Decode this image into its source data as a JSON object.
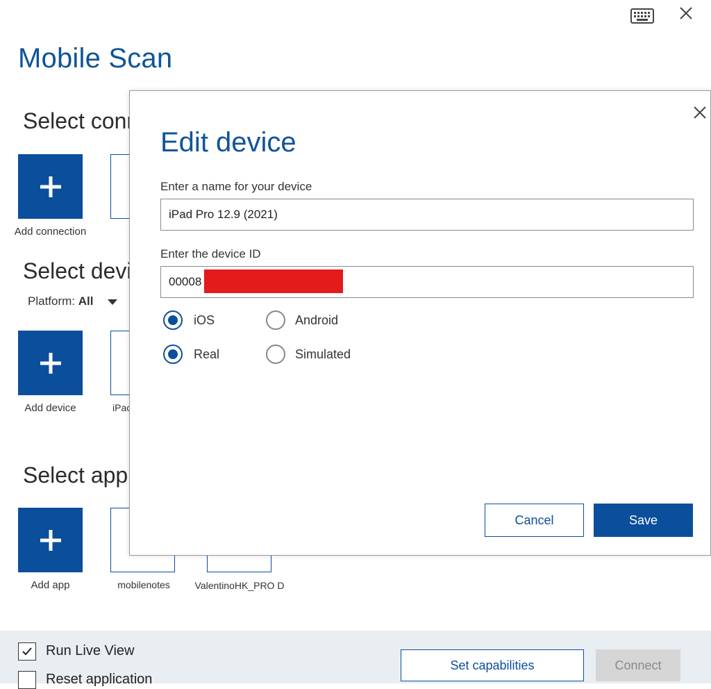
{
  "window": {
    "title": "Mobile Scan",
    "icons": [
      "keyboard-icon",
      "close-icon"
    ]
  },
  "sections": {
    "connection": {
      "title": "Select conn",
      "add_label": "Add connection"
    },
    "device": {
      "title": "Select devi",
      "add_label": "Add device",
      "platform_label": "Platform:",
      "platform_value": "All",
      "tile_label": "iPac"
    },
    "application": {
      "title": "Select appl",
      "add_label": "Add app",
      "apps": [
        "mobilenotes",
        "ValentinoHK_PRO D"
      ]
    }
  },
  "bottom": {
    "run_live_view": {
      "label": "Run Live View",
      "checked": true
    },
    "reset_application": {
      "label": "Reset application",
      "checked": false
    },
    "set_capabilities": "Set capabilities",
    "connect": "Connect"
  },
  "dialog": {
    "title": "Edit device",
    "name_label": "Enter a name for your device",
    "name_value": "iPad Pro 12.9 (2021)",
    "id_label": "Enter the device ID",
    "id_value": "00008",
    "os_options": [
      {
        "label": "iOS",
        "selected": true
      },
      {
        "label": "Android",
        "selected": false
      }
    ],
    "type_options": [
      {
        "label": "Real",
        "selected": true
      },
      {
        "label": "Simulated",
        "selected": false
      }
    ],
    "cancel": "Cancel",
    "save": "Save"
  },
  "colors": {
    "accent": "#0b4e9c",
    "title": "#0f5497",
    "redaction": "#e31b1b",
    "bottom_bar": "#e9eef3"
  }
}
